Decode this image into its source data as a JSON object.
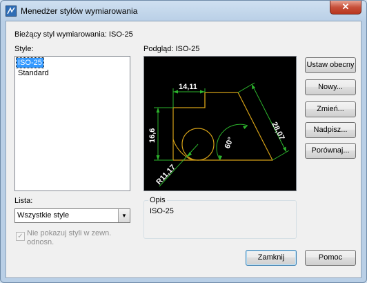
{
  "window": {
    "title": "Menedżer stylów wymiarowania",
    "close_glyph": "✕"
  },
  "current_style": "Bieżący styl wymiarowania: ISO-25",
  "styles": {
    "label": "Style:",
    "items": [
      "ISO-25",
      "Standard"
    ],
    "selected": "ISO-25"
  },
  "preview": {
    "label": "Podgląd: ISO-25",
    "dimensions": {
      "top_width": "14,11",
      "left_height": "16,6",
      "slant": "28,07",
      "angle": "60°",
      "radius": "R11,17"
    },
    "colors": {
      "geometry": "#d4a017",
      "dimension": "#2db52d",
      "text": "#ffffff",
      "background": "#000000"
    }
  },
  "buttons": {
    "set_current": "Ustaw obecny",
    "new": "Nowy...",
    "modify": "Zmień...",
    "override": "Nadpisz...",
    "compare": "Porównaj...",
    "close": "Zamknij",
    "help": "Pomoc"
  },
  "filter": {
    "label": "Lista:",
    "value": "Wszystkie style"
  },
  "xref_checkbox": {
    "label": "Nie pokazuj styli w zewn. odnosn.",
    "checked": true,
    "enabled": false
  },
  "description": {
    "legend": "Opis",
    "text": "ISO-25"
  }
}
